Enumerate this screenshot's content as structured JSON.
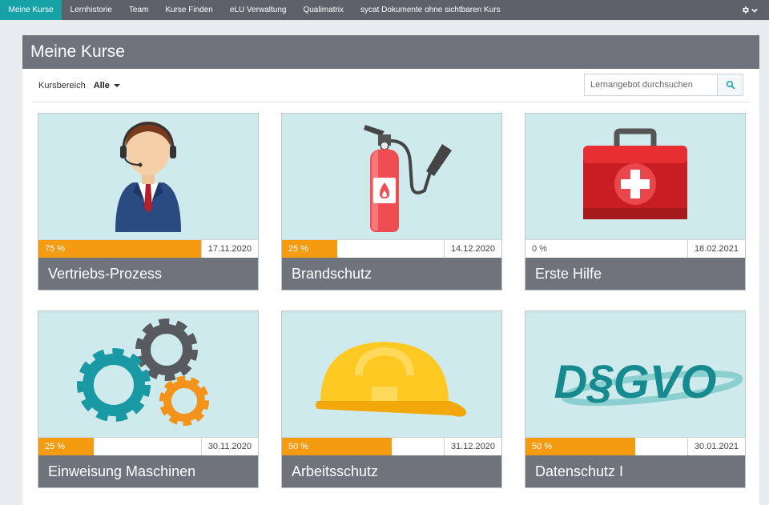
{
  "nav": {
    "items": [
      "Meine Kurse",
      "Lernhistorie",
      "Team",
      "Kurse Finden",
      "eLU Verwaltung",
      "Qualimatrix",
      "sycat Dokumente ohne sichtbaren Kurs"
    ],
    "active_index": 0,
    "settings_icon": "gear-icon"
  },
  "page": {
    "title": "Meine Kurse"
  },
  "filter": {
    "label": "Kursbereich",
    "value": "Alle"
  },
  "search": {
    "placeholder": "Lernangebot durchsuchen",
    "icon": "search-icon"
  },
  "colors": {
    "accent": "#17a2a8",
    "progress": "#f59b12",
    "header": "#6f747c",
    "card_bg": "#cfeaec"
  },
  "courses": [
    {
      "title": "Vertriebs-Prozess",
      "progress_label": "75 %",
      "progress": 0.75,
      "date": "17.11.2020",
      "image": "support-agent-icon"
    },
    {
      "title": "Brandschutz",
      "progress_label": "25 %",
      "progress": 0.25,
      "date": "14.12.2020",
      "image": "fire-extinguisher-icon"
    },
    {
      "title": "Erste Hilfe",
      "progress_label": "0 %",
      "progress": 0,
      "date": "18.02.2021",
      "image": "first-aid-kit-icon"
    },
    {
      "title": "Einweisung Maschinen",
      "progress_label": "25 %",
      "progress": 0.25,
      "date": "30.11.2020",
      "image": "gears-icon"
    },
    {
      "title": "Arbeitsschutz",
      "progress_label": "50 %",
      "progress": 0.5,
      "date": "31.12.2020",
      "image": "hard-hat-icon"
    },
    {
      "title": "Datenschutz I",
      "progress_label": "50 %",
      "progress": 0.5,
      "date": "30.01.2021",
      "image": "dsgvo-logo",
      "image_text": "D§GVO"
    }
  ]
}
